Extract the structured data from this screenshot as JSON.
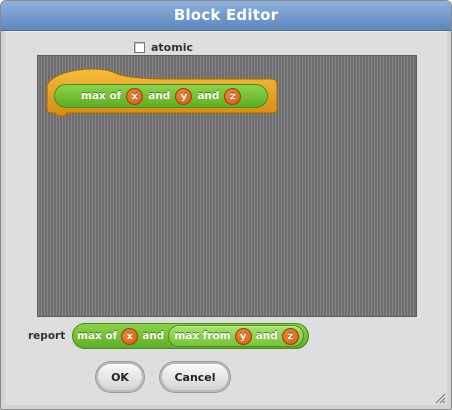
{
  "window": {
    "title": "Block Editor"
  },
  "options": {
    "atomic_label": "atomic",
    "atomic_checked": false
  },
  "prototype": {
    "words": [
      "max of",
      "and",
      "and"
    ],
    "params": [
      "x",
      "y",
      "z"
    ]
  },
  "report": {
    "label": "report",
    "outer": {
      "text1": "max of",
      "param1": "x",
      "text2": "and"
    },
    "inner": {
      "text1": "max from",
      "param1": "y",
      "text2": "and",
      "param2": "z"
    }
  },
  "buttons": {
    "ok": "OK",
    "cancel": "Cancel"
  },
  "colors": {
    "titlebar": "#6f96c9",
    "hat_block": "#e8a317",
    "reporter_block": "#6cbb2e",
    "param_bubble": "#e07020",
    "scripts_bg": "#7a7a7c"
  },
  "icons": {
    "resize": "resize-grip-icon",
    "checkbox": "checkbox-unchecked-icon"
  }
}
